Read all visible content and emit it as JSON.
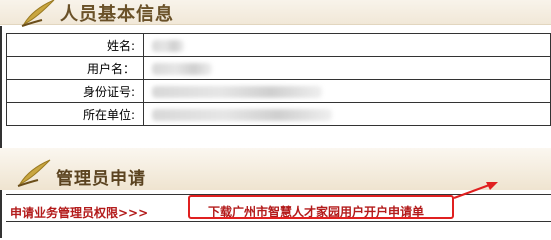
{
  "section1": {
    "title": "人员基本信息"
  },
  "fields": [
    {
      "label": "姓名:",
      "blur_width": 32
    },
    {
      "label": "用户名：",
      "blur_width": 60
    },
    {
      "label": "身份证号:",
      "blur_width": 170
    },
    {
      "label": "所在单位:",
      "blur_width": 180
    }
  ],
  "section2": {
    "title": "管理员申请"
  },
  "links": {
    "apply": "申请业务管理员权限>>>",
    "download": "下载广州市智慧人才家园用户开户申请单"
  },
  "colors": {
    "link": "#b31b1b",
    "annotation": "#e02020",
    "header_text": "#6a5128"
  }
}
